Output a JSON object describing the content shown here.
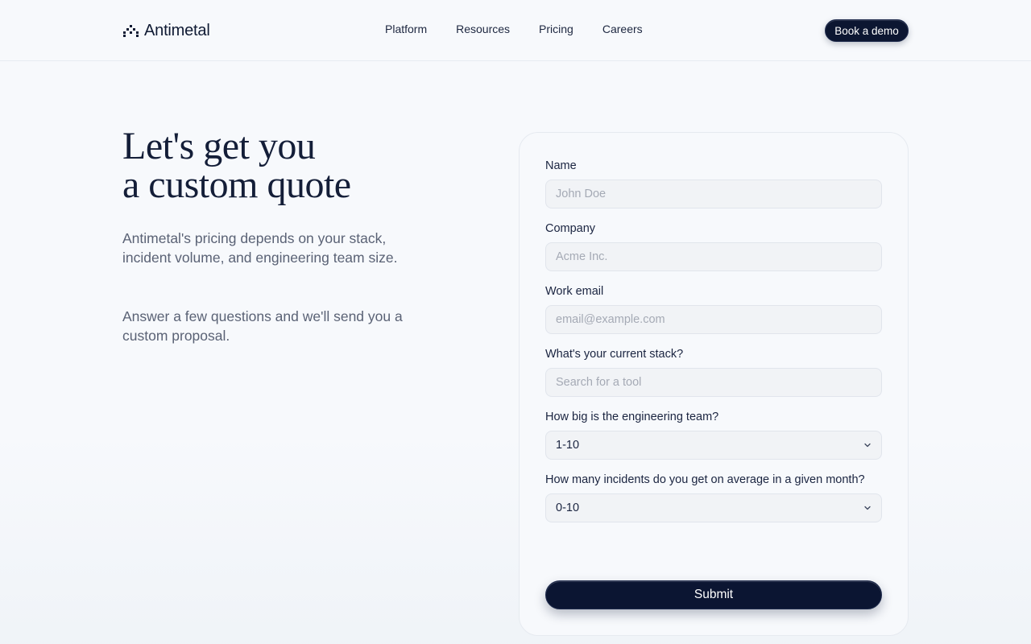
{
  "header": {
    "brand": "Antimetal",
    "nav": [
      "Platform",
      "Resources",
      "Pricing",
      "Careers"
    ],
    "cta": "Book a demo"
  },
  "hero": {
    "title_line1": "Let's get you",
    "title_line2": "a custom quote",
    "paragraph1": "Antimetal's pricing depends on your stack, incident volume, and engineering team size.",
    "paragraph2": "Answer a few questions and we'll send you a custom proposal."
  },
  "form": {
    "name_label": "Name",
    "name_placeholder": "John Doe",
    "company_label": "Company",
    "company_placeholder": "Acme Inc.",
    "email_label": "Work email",
    "email_placeholder": "email@example.com",
    "stack_label": "What's your current stack?",
    "stack_placeholder": "Search for a tool",
    "team_label": "How big is the engineering team?",
    "team_value": "1-10",
    "incidents_label": "How many incidents do you get on average in a given month?",
    "incidents_value": "0-10",
    "submit_label": "Submit"
  },
  "colors": {
    "background": "#f7f9fc",
    "primary_dark": "#0b1532",
    "text_muted": "#5a6275"
  }
}
